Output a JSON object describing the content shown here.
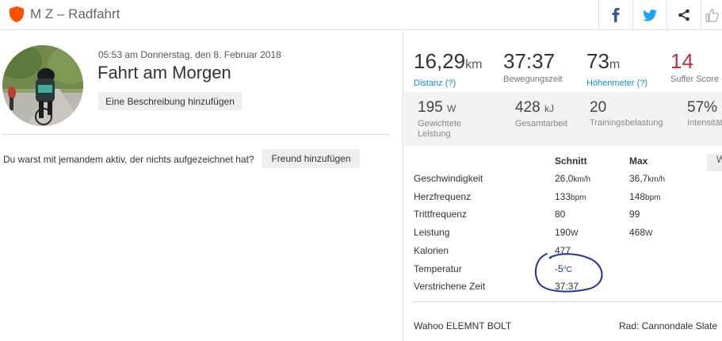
{
  "header": {
    "title": "M Z – Radfahrt",
    "share_icons": [
      "facebook-icon",
      "twitter-icon",
      "share-icon",
      "thumbs-up-icon"
    ],
    "brand_color": "#fc5200"
  },
  "activity": {
    "date": "05:53 am Donnerstag, den 8. Februar 2018",
    "name": "Fahrt am Morgen",
    "add_description_label": "Eine Beschreibung hinzufügen",
    "question": "Du warst mit jemandem aktiv, der nichts aufgezeichnet hat?",
    "add_friend_label": "Freund hinzufügen"
  },
  "stats": [
    {
      "value": "16,29",
      "unit": "km",
      "label": "Distanz (?)"
    },
    {
      "value": "37:37",
      "unit": "",
      "label": "Bewegungszeit"
    },
    {
      "value": "73",
      "unit": "m",
      "label": "Höhenmeter (?)"
    },
    {
      "value": "14",
      "unit": "",
      "label": "Suffer Score"
    }
  ],
  "stats2": [
    {
      "value": "195",
      "unit": "W",
      "label": "Gewichtete Leistung"
    },
    {
      "value": "428",
      "unit": "kJ",
      "label": "Gesamtarbeit"
    },
    {
      "value": "20",
      "unit": "",
      "label": "Trainingsbelastung"
    },
    {
      "value": "57%",
      "unit": "",
      "label": "Intensität"
    }
  ],
  "table": {
    "headers": {
      "avg": "Schnitt",
      "max": "Max"
    },
    "side_button": "W",
    "rows": [
      {
        "label": "Geschwindigkeit",
        "avg": "26,0",
        "avg_unit": "km/h",
        "max": "36,7",
        "max_unit": "km/h"
      },
      {
        "label": "Herzfrequenz",
        "avg": "133",
        "avg_unit": "bpm",
        "max": "148",
        "max_unit": "bpm"
      },
      {
        "label": "Trittfrequenz",
        "avg": "80",
        "avg_unit": "",
        "max": "99",
        "max_unit": ""
      },
      {
        "label": "Leistung",
        "avg": "190",
        "avg_unit": "W",
        "max": "468",
        "max_unit": "W"
      },
      {
        "label": "Kalorien",
        "avg": "477",
        "avg_unit": "",
        "max": "",
        "max_unit": ""
      },
      {
        "label": "Temperatur",
        "avg": "-5",
        "avg_unit": "°C",
        "max": "",
        "max_unit": ""
      },
      {
        "label": "Verstrichene Zeit",
        "avg": "37:37",
        "avg_unit": "",
        "max": "",
        "max_unit": ""
      }
    ]
  },
  "footer": {
    "device": "Wahoo ELEMNT BOLT",
    "bike": "Rad: Cannondale Slate"
  },
  "annotation_color": "#1f2fa8"
}
